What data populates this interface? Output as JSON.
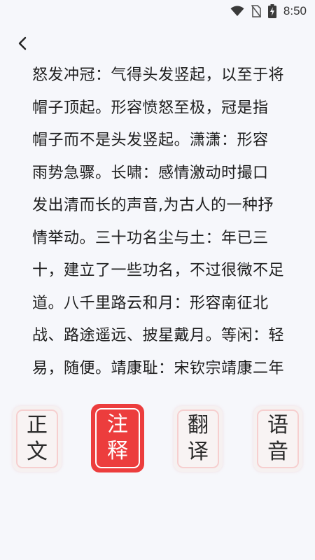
{
  "status_bar": {
    "time": "8:50"
  },
  "content": {
    "lines": [
      "怒发冲冠：气得头发竖起，以至于将",
      "帽子顶起。形容愤怒至极，冠是指",
      "帽子而不是头发竖起。潇潇：形容",
      "雨势急骤。长啸：感情激动时撮口",
      "发出清而长的声音,为古人的一种抒",
      "情举动。三十功名尘与土：年已三",
      "十，建立了一些功名，不过很微不足",
      "道。八千里路云和月：形容南征北",
      "战、路途遥远、披星戴月。等闲：轻",
      "易，随便。靖康耻：宋钦宗靖康二年"
    ]
  },
  "tabs": [
    {
      "line1": "正",
      "line2": "文",
      "active": false
    },
    {
      "line1": "注",
      "line2": "释",
      "active": true
    },
    {
      "line1": "翻",
      "line2": "译",
      "active": false
    },
    {
      "line1": "语",
      "line2": "音",
      "active": false
    }
  ],
  "colors": {
    "accent": "#ec3d3d",
    "tab_border": "#f6cfcf",
    "background": "#f6f7fb"
  },
  "icons": [
    "wifi-icon",
    "no-sim-icon",
    "battery-charging-icon",
    "back-arrow-icon"
  ]
}
